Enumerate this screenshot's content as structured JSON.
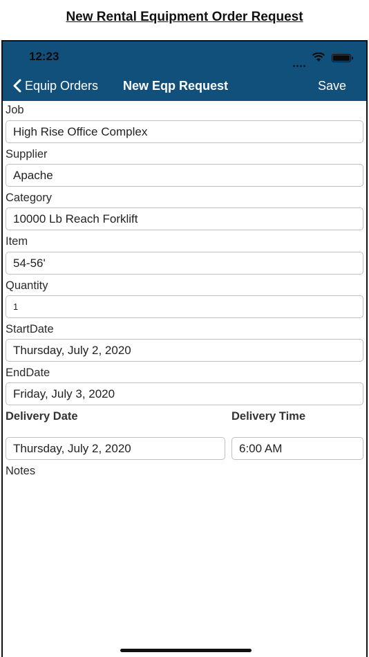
{
  "doc_title": "New Rental Equipment Order Request",
  "status_bar": {
    "time": "12:23",
    "icons": [
      "signal-dots-icon",
      "wifi-icon",
      "battery-icon"
    ]
  },
  "nav": {
    "back_label": "Equip Orders",
    "title": "New Eqp Request",
    "save_label": "Save"
  },
  "colors": {
    "nav_background": "#12507c",
    "nav_text": "#ffffff",
    "field_border": "#bfbfbf"
  },
  "fields": {
    "job": {
      "label": "Job",
      "value": "High Rise Office Complex"
    },
    "supplier": {
      "label": "Supplier",
      "value": "Apache"
    },
    "category": {
      "label": "Category",
      "value": "10000 Lb Reach Forklift"
    },
    "item": {
      "label": "Item",
      "value": "54-56'"
    },
    "quantity": {
      "label": "Quantity",
      "value": "1"
    },
    "start_date": {
      "label": "StartDate",
      "value": "Thursday, July 2, 2020"
    },
    "end_date": {
      "label": "EndDate",
      "value": "Friday, July 3, 2020"
    },
    "delivery_date": {
      "label": "Delivery Date",
      "value": "Thursday, July 2, 2020"
    },
    "delivery_time": {
      "label": "Delivery Time",
      "value": "6:00 AM"
    },
    "notes": {
      "label": "Notes"
    }
  }
}
